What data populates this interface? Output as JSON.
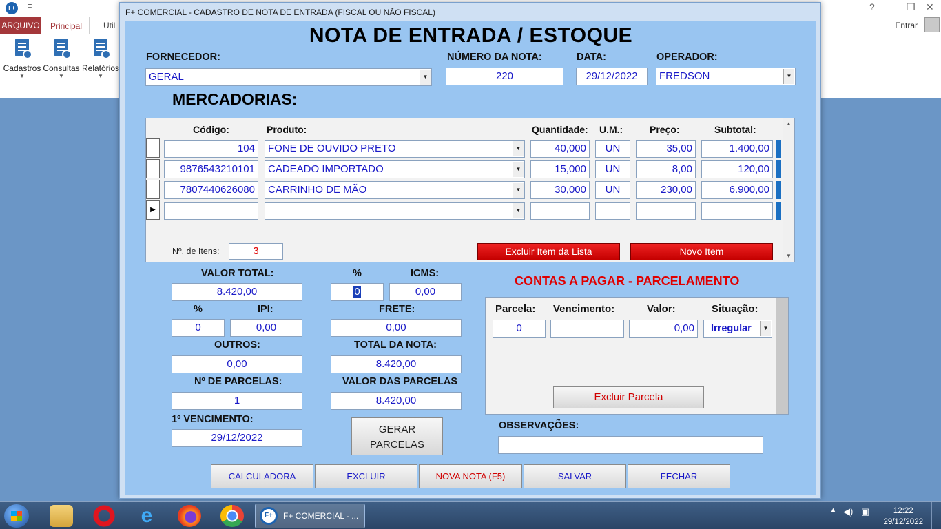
{
  "background_app": {
    "qat": "≡",
    "help": "?",
    "signin": "Entrar",
    "tabs": [
      "ARQUIVO",
      "Principal",
      "Util"
    ],
    "ribbon": [
      "Cadastros",
      "Consultas",
      "Relatórios"
    ]
  },
  "window": {
    "title": "F+ COMERCIAL - CADASTRO DE NOTA DE ENTRADA (FISCAL OU NÃO FISCAL)"
  },
  "header": {
    "title": "NOTA DE ENTRADA / ESTOQUE",
    "fornecedor_label": "FORNECEDOR:",
    "fornecedor_value": "GERAL",
    "numero_label": "NÚMERO DA NOTA:",
    "numero_value": "220",
    "data_label": "DATA:",
    "data_value": "29/12/2022",
    "operador_label": "OPERADOR:",
    "operador_value": "FREDSON"
  },
  "items": {
    "section_title": "MERCADORIAS:",
    "columns": [
      "Código:",
      "Produto:",
      "Quantidade:",
      "U.M.:",
      "Preço:",
      "Subtotal:"
    ],
    "rows": [
      {
        "codigo": "104",
        "produto": "FONE DE OUVIDO PRETO",
        "quantidade": "40,000",
        "um": "UN",
        "preco": "35,00",
        "subtotal": "1.400,00"
      },
      {
        "codigo": "9876543210101",
        "produto": "CADEADO IMPORTADO",
        "quantidade": "15,000",
        "um": "UN",
        "preco": "8,00",
        "subtotal": "120,00"
      },
      {
        "codigo": "7807440626080",
        "produto": "CARRINHO DE MÃO",
        "quantidade": "30,000",
        "um": "UN",
        "preco": "230,00",
        "subtotal": "6.900,00"
      }
    ],
    "count_label": "Nº. de Itens:",
    "count_value": "3",
    "delete_button": "Excluir Item da Lista",
    "new_button": "Novo Item"
  },
  "totals": {
    "valor_total_label": "VALOR TOTAL:",
    "valor_total": "8.420,00",
    "pct_label": "%",
    "pct_icms": "0",
    "icms_label": "ICMS:",
    "icms": "0,00",
    "pct_ipi_label": "%",
    "pct_ipi": "0",
    "ipi_label": "IPI:",
    "ipi": "0,00",
    "frete_label": "FRETE:",
    "frete": "0,00",
    "outros_label": "OUTROS:",
    "outros": "0,00",
    "total_nota_label": "TOTAL DA NOTA:",
    "total_nota": "8.420,00",
    "num_parcelas_label": "Nº DE PARCELAS:",
    "num_parcelas": "1",
    "valor_parcelas_label": "VALOR DAS PARCELAS",
    "valor_parcelas": "8.420,00",
    "vencimento_label": "1º VENCIMENTO:",
    "vencimento": "29/12/2022",
    "gerar_line1": "GERAR",
    "gerar_line2": "PARCELAS"
  },
  "contas": {
    "title": "CONTAS A PAGAR - PARCELAMENTO",
    "columns": [
      "Parcela:",
      "Vencimento:",
      "Valor:",
      "Situação:"
    ],
    "row": {
      "parcela": "0",
      "vencimento": "",
      "valor": "0,00",
      "situacao": "Irregular"
    },
    "delete_button": "Excluir Parcela",
    "obs_label": "OBSERVAÇÕES:",
    "obs_value": ""
  },
  "buttons": [
    "CALCULADORA",
    "EXCLUIR",
    "NOVA NOTA (F5)",
    "SALVAR",
    "FECHAR"
  ],
  "taskbar": {
    "active_app": "F+ COMERCIAL - ...",
    "time": "12:22",
    "date": "29/12/2022"
  }
}
